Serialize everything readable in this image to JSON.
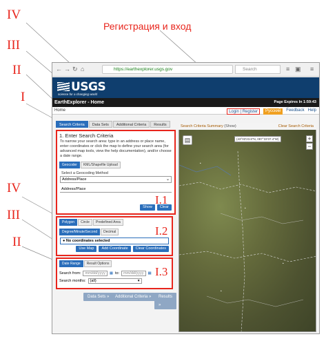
{
  "annotations": {
    "left_top": [
      "IV",
      "III",
      "II",
      "I"
    ],
    "left_bottom": [
      "IV",
      "III",
      "II"
    ],
    "boxes": [
      "I.1",
      "I.2",
      "I.3"
    ],
    "caption": "Регистрация и вход",
    "color": "#e8251c"
  },
  "browser": {
    "url": "https://earthexplorer.usgs.gov",
    "search_placeholder": "Search"
  },
  "header": {
    "logo": "USGS",
    "tagline": "science for a changing world",
    "app_title": "EarthExplorer - Home",
    "expiry": "Page Expires In 1:59:43"
  },
  "menu": {
    "home": "Home",
    "login": "Login",
    "register": "Register",
    "language": "Русский",
    "feedback": "Feedback",
    "help": "Help"
  },
  "tabs": [
    "Search Criteria",
    "Data Sets",
    "Additional Criteria",
    "Results"
  ],
  "search_criteria": {
    "title": "1. Enter Search Criteria",
    "description": "To narrow your search area: type in an address or place name, enter coordinates or click the map to define your search area (for advanced map tools, view the help documentation), and/or choose a date range.",
    "subtabs": [
      "Geocoder",
      "KML/Shapefile Upload"
    ],
    "method_label": "Select a Geocoding Method",
    "method_value": "Address/Place",
    "input_value": "Address/Place",
    "show_button": "Show",
    "clear_button": "Clear"
  },
  "coordinates": {
    "tabs": [
      "Polygon",
      "Circle",
      "Predefined Area"
    ],
    "format_options": [
      "Degree/Minute/Second",
      "Decimal"
    ],
    "status": "No coordinates selected",
    "buttons": [
      "Use Map",
      "Add Coordinate",
      "Clear Coordinates"
    ]
  },
  "date": {
    "tabs": [
      "Date Range",
      "Result Options"
    ],
    "from_label": "Search from:",
    "from_placeholder": "mm/dd/yyyy",
    "to_label": "to:",
    "to_placeholder": "mm/dd/yyyy",
    "months_label": "Search months:",
    "months_value": "(all)"
  },
  "bottom_buttons": [
    "Data Sets »",
    "Additional Criteria »",
    "Results »"
  ],
  "map": {
    "summary_label": "Search Criteria Summary",
    "summary_show": "(Show)",
    "clear": "Clear Search Criteria",
    "coord_readout": "(43°03'23.8\"N, 097°33'37.4\"W)",
    "zoom_in": "+",
    "zoom_out": "−"
  }
}
